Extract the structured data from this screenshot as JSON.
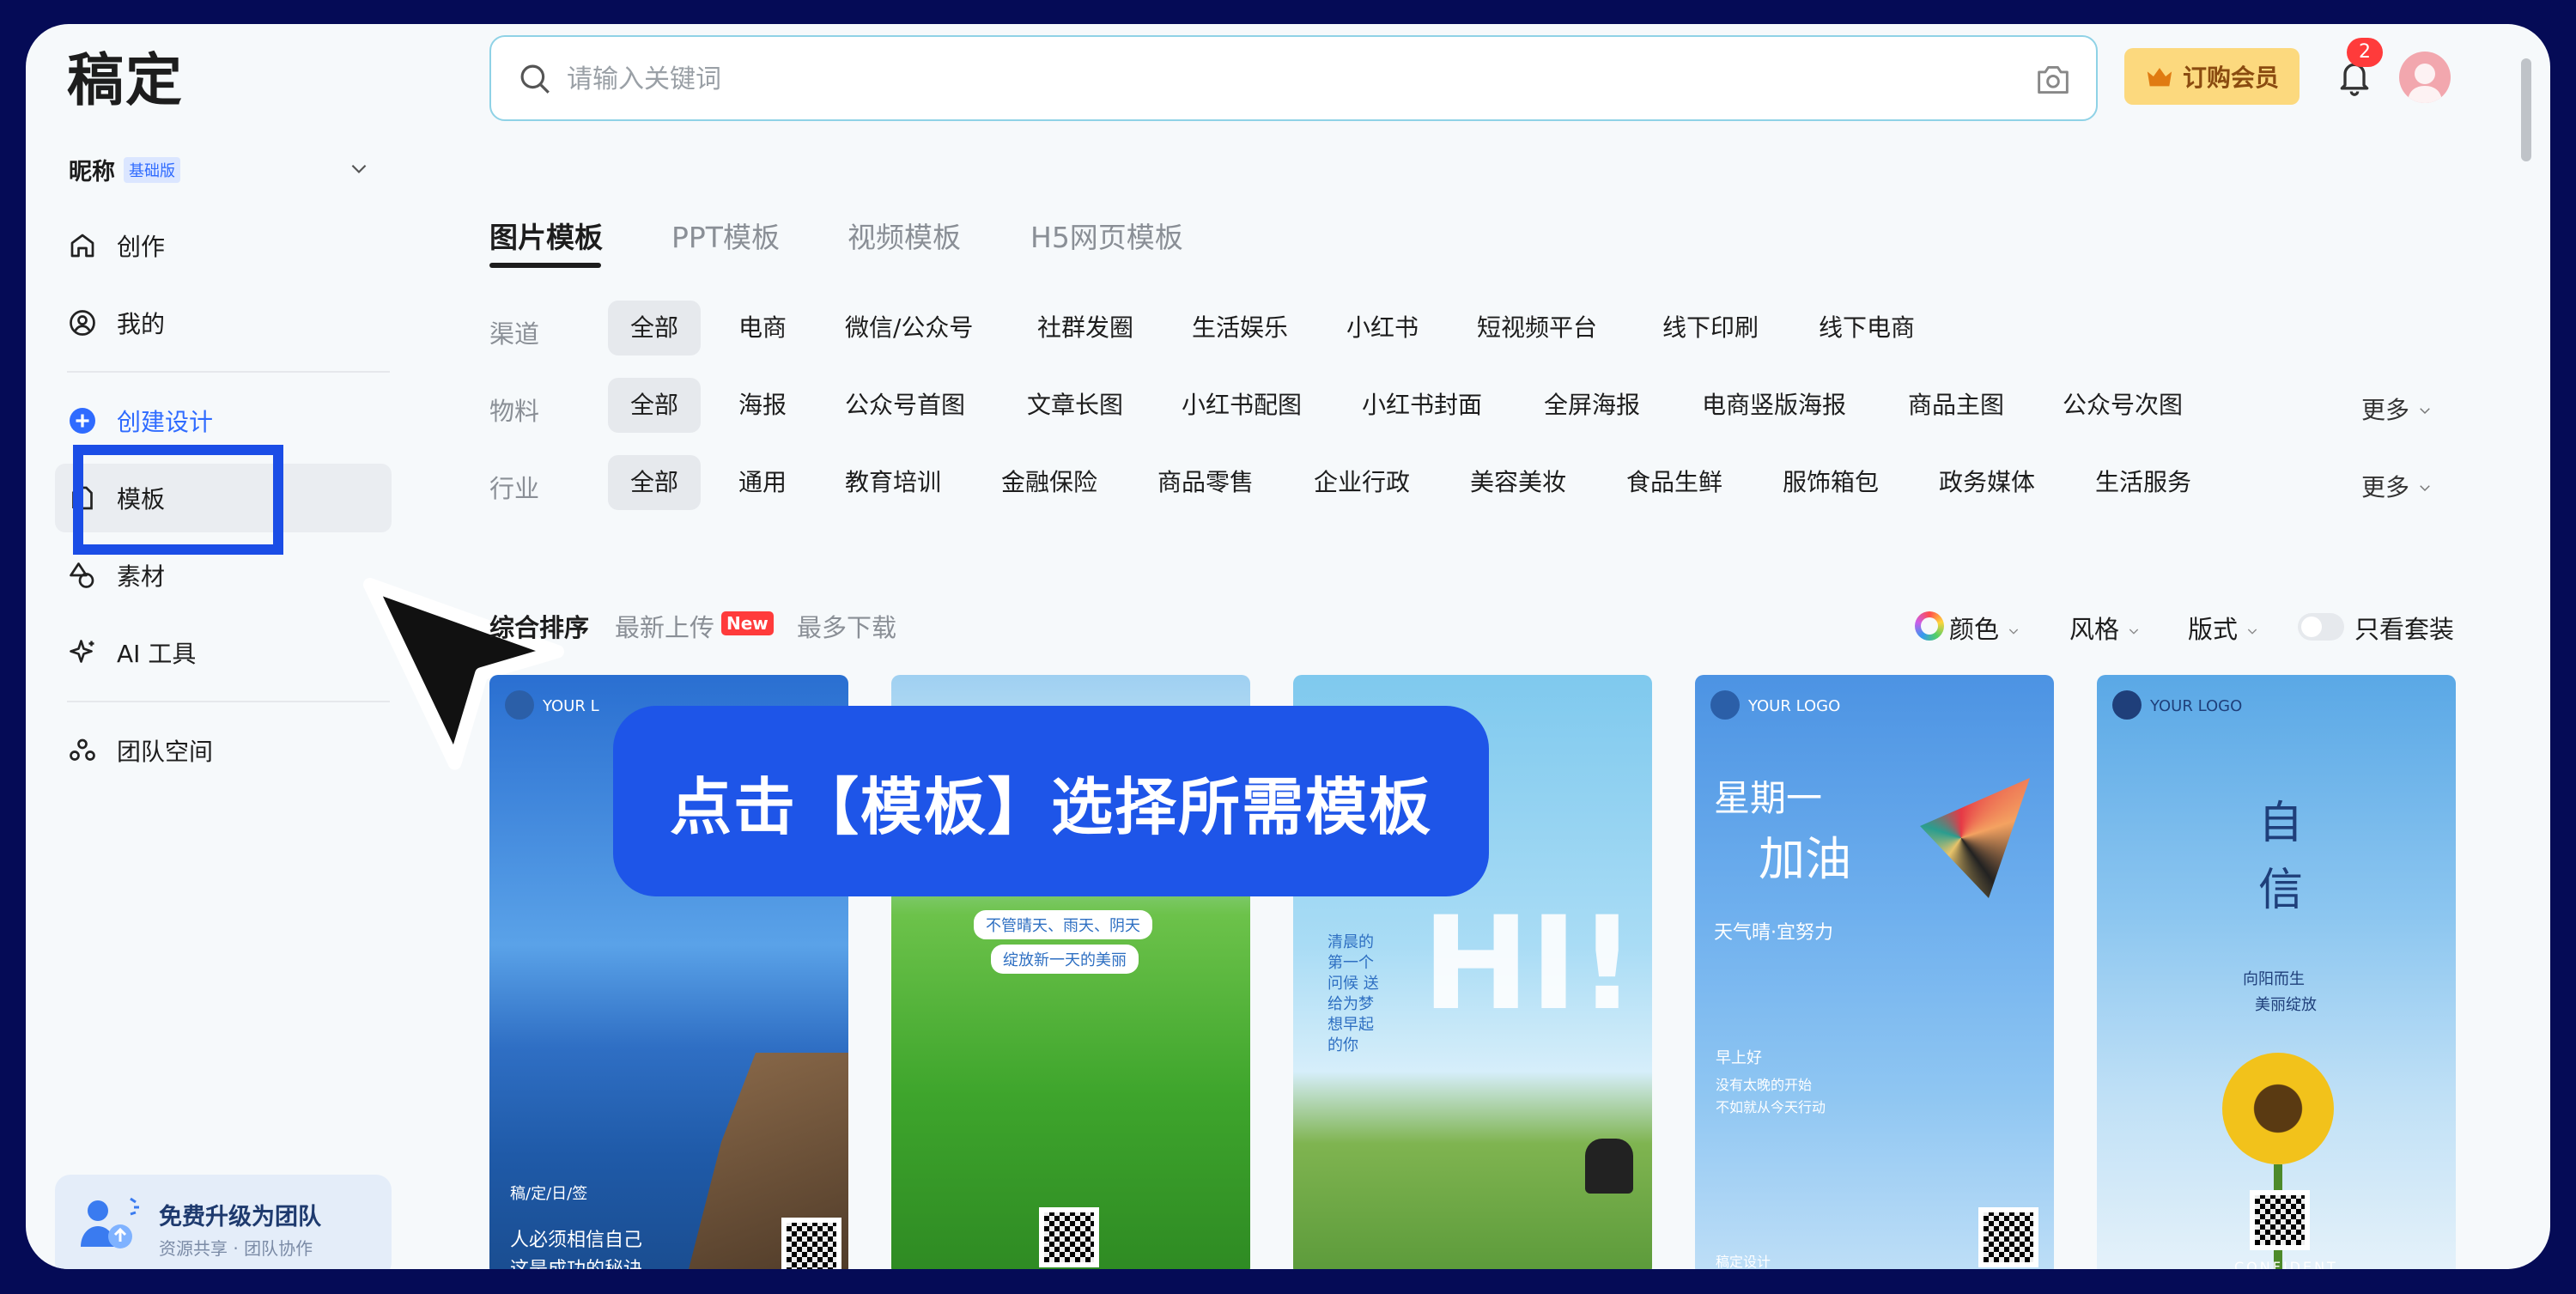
{
  "app": {
    "logo": "稿定"
  },
  "user": {
    "nickname": "昵称",
    "plan_badge": "基础版"
  },
  "nav": {
    "create": "创作",
    "mine": "我的",
    "create_design": "创建设计",
    "templates": "模板",
    "materials": "素材",
    "ai_tools": "AI 工具",
    "team_space": "团队空间"
  },
  "upgrade": {
    "title": "免费升级为团队",
    "subtitle": "资源共享 · 团队协作"
  },
  "search": {
    "placeholder": "请输入关键词"
  },
  "header": {
    "vip_label": "订购会员",
    "notification_count": "2"
  },
  "tabs": [
    "图片模板",
    "PPT模板",
    "视频模板",
    "H5网页模板"
  ],
  "filters": {
    "channel": {
      "label": "渠道",
      "options": [
        "全部",
        "电商",
        "微信/公众号",
        "社群发圈",
        "生活娱乐",
        "小红书",
        "短视频平台",
        "线下印刷",
        "线下电商"
      ]
    },
    "material": {
      "label": "物料",
      "options": [
        "全部",
        "海报",
        "公众号首图",
        "文章长图",
        "小红书配图",
        "小红书封面",
        "全屏海报",
        "电商竖版海报",
        "商品主图",
        "公众号次图"
      ],
      "more": "更多"
    },
    "industry": {
      "label": "行业",
      "options": [
        "全部",
        "通用",
        "教育培训",
        "金融保险",
        "商品零售",
        "企业行政",
        "美容美妆",
        "食品生鲜",
        "服饰箱包",
        "政务媒体",
        "生活服务"
      ],
      "more": "更多"
    }
  },
  "sort": {
    "comprehensive": "综合排序",
    "latest": "最新上传",
    "new_badge": "New",
    "most_downloads": "最多下载",
    "color": "颜色",
    "style": "风格",
    "layout": "版式",
    "only_sets": "只看套装"
  },
  "cards": {
    "c1": {
      "logo": "YOUR L",
      "tag": "稿/定/日/签",
      "line1": "人必须相信自己",
      "line2": "这是成功的秘诀"
    },
    "c2": {
      "line1": "不管晴天、雨天、阴天",
      "line2": "绽放新一天的美丽"
    },
    "c3": {
      "big": "HI!",
      "poem": "清晨的第一个问候 送给为梦想早起的你"
    },
    "c4": {
      "logo": "YOUR LOGO",
      "title1": "星期一",
      "title2": "加油",
      "sub": "天气晴·宜努力",
      "greet": "早上好",
      "l1": "没有太晚的开始",
      "l2": "不如就从今天行动",
      "footer": "稿定设计"
    },
    "c5": {
      "logo": "YOUR LOGO",
      "title1": "自",
      "title2": "信",
      "l1": "向阳而生",
      "l2": "美丽绽放",
      "footer": "CONFIDENT"
    }
  },
  "overlay": {
    "caption": "点击【模板】选择所需模板"
  }
}
